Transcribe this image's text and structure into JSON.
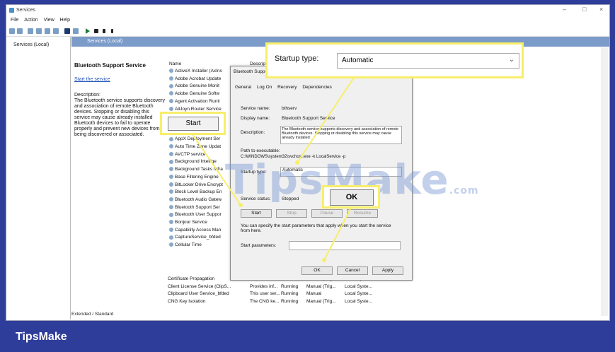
{
  "window": {
    "title": "Services",
    "controls": [
      "–",
      "□",
      "×"
    ]
  },
  "menu": [
    "File",
    "Action",
    "View",
    "Help"
  ],
  "tree": {
    "node": "Services (Local)"
  },
  "header": {
    "tab": "Services (Local)"
  },
  "detail": {
    "title": "Bluetooth Support Service",
    "link": "Start the service",
    "desc_label": "Description:",
    "desc_text": "The Bluetooth service supports discovery and association of remote Bluetooth devices. Stopping or disabling this service may cause already installed Bluetooth devices to fail to operate properly and prevent new devices from being discovered or associated."
  },
  "list": {
    "name_header": "Name",
    "desc_header": "Description",
    "rows": [
      "ActiveX Installer (AxIns",
      "Adobe Acrobat Update",
      "Adobe Genuine Monit",
      "Adobe Genuine Softw",
      "Agent Activation Runti",
      "AllJoyn Router Service",
      "App Readiness",
      "Application Informati",
      "Application Layer Gate",
      "AppX Deployment Ser",
      "Auto Time Zone Updat",
      "AVCTP service",
      "Background Intellige",
      "Background Tasks Infra",
      "Base Filtering Engine",
      "BitLocker Drive Encrypt",
      "Block Level Backup En",
      "Bluetooth Audio Gatew",
      "Bluetooth Support Ser",
      "Bluetooth User Suppor",
      "Bonjour Service",
      "Capability Access Man",
      "CaptureService_bfded",
      "Cellular Time"
    ],
    "bottom_rows": [
      {
        "name": "Certificate Propagation",
        "desc": "Copies user...",
        "status": "",
        "startup": "Manual (Trig...",
        "logon": "Local Syste..."
      },
      {
        "name": "Client License Service (ClipS...",
        "desc": "Provides inf...",
        "status": "Running",
        "startup": "Manual (Trig...",
        "logon": "Local Syste..."
      },
      {
        "name": "Clipboard User Service_bfded",
        "desc": "This user ser...",
        "status": "Running",
        "startup": "Manual",
        "logon": "Local Syste..."
      },
      {
        "name": "CNG Key Isolation",
        "desc": "The CNG ke...",
        "status": "Running",
        "startup": "Manual (Trig...",
        "logon": "Local Syste..."
      }
    ]
  },
  "dialog": {
    "title": "Bluetooth Support Service Properties (Local Computer)",
    "tabs": [
      "General",
      "Log On",
      "Recovery",
      "Dependencies"
    ],
    "service_name_label": "Service name:",
    "service_name": "bthserv",
    "display_name_label": "Display name:",
    "display_name": "Bluetooth Support Service",
    "description_label": "Description:",
    "description": "The Bluetooth service supports discovery and association of remote Bluetooth devices. Stopping or disabling this service may cause already installed",
    "path_label": "Path to executable:",
    "path": "C:\\WINDOWS\\system32\\svchost.exe -k LocalService -p",
    "startup_label": "Startup type:",
    "startup_value": "Automatic",
    "status_label": "Service status:",
    "status_value": "Stopped",
    "btn_start": "Start",
    "btn_stop": "Stop",
    "btn_pause": "Pause",
    "btn_resume": "Resume",
    "params_note": "You can specify the start parameters that apply when you start the service from here.",
    "params_label": "Start parameters:",
    "ok": "OK",
    "cancel": "Cancel",
    "apply": "Apply"
  },
  "callouts": {
    "startup_label": "Startup type:",
    "startup_value": "Automatic",
    "start": "Start",
    "ok": "OK",
    "color": "#f7ee6a"
  },
  "bottom_tabs": [
    "Extended",
    "Standard"
  ],
  "watermark": {
    "main": "TipsMake",
    "suffix": ".com"
  },
  "brand": "TipsMake"
}
